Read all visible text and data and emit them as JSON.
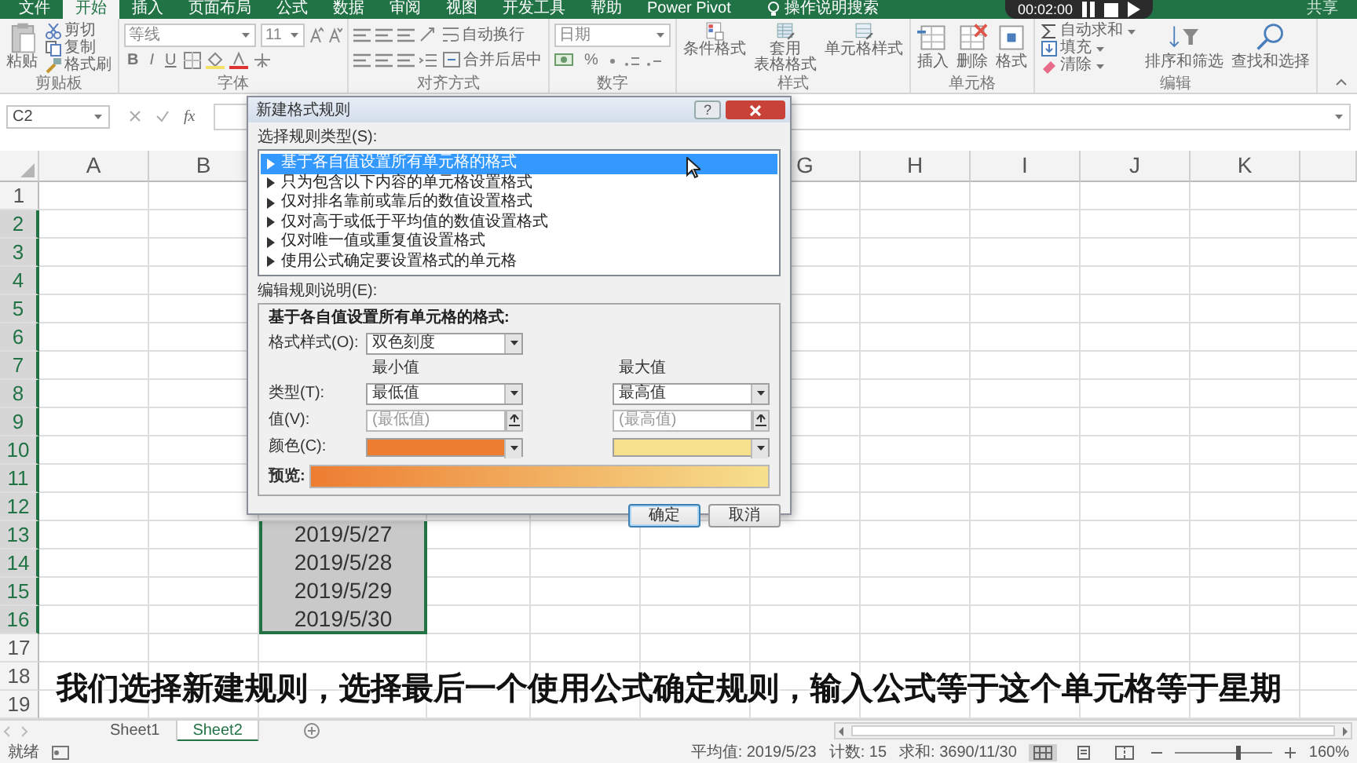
{
  "ribbon_tabs": [
    {
      "label": "文件",
      "selected": false
    },
    {
      "label": "开始",
      "selected": true
    },
    {
      "label": "插入",
      "selected": false
    },
    {
      "label": "页面布局",
      "selected": false
    },
    {
      "label": "公式",
      "selected": false
    },
    {
      "label": "数据",
      "selected": false
    },
    {
      "label": "审阅",
      "selected": false
    },
    {
      "label": "视图",
      "selected": false
    },
    {
      "label": "开发工具",
      "selected": false
    },
    {
      "label": "帮助",
      "selected": false
    },
    {
      "label": "Power Pivot",
      "selected": false
    }
  ],
  "tell_me": "操作说明搜索",
  "share": "共享",
  "video_controls": {
    "time": "00:02:00"
  },
  "ribbon_groups": [
    {
      "kind": "clipboard",
      "label": "剪贴板",
      "paste": "粘贴",
      "items": [
        "剪切",
        "复制",
        "格式刷"
      ]
    },
    {
      "kind": "font",
      "label": "字体",
      "font_name": "等线",
      "font_size": "11",
      "styles": [
        "B",
        "I",
        "U"
      ]
    },
    {
      "kind": "alignment",
      "label": "对齐方式",
      "wrap": "自动换行",
      "merge": "合并后居中"
    },
    {
      "kind": "number",
      "label": "数字",
      "format": "日期",
      "percent": "%"
    },
    {
      "kind": "styles",
      "label": "样式",
      "buttons": [
        [
          "条件格式"
        ],
        [
          "套用",
          "表格格式"
        ],
        [
          "单元格样式"
        ]
      ]
    },
    {
      "kind": "cells",
      "label": "单元格",
      "buttons": [
        "插入",
        "删除",
        "格式"
      ]
    },
    {
      "kind": "editing",
      "label": "编辑",
      "items": [
        "自动求和",
        "填充",
        "清除"
      ],
      "buttons": [
        "排序和筛选",
        "查找和选择"
      ]
    }
  ],
  "formula_bar": {
    "name_box": "C2",
    "function_label": "fx"
  },
  "sheet": {
    "columns": [
      "A",
      "B",
      null,
      null,
      null,
      null,
      "G",
      "H",
      "I",
      "J",
      "K"
    ],
    "rows": [
      {
        "label": "1",
        "selected": false
      },
      {
        "label": "2",
        "selected": true
      },
      {
        "label": "3",
        "selected": true
      },
      {
        "label": "4",
        "selected": true
      },
      {
        "label": "5",
        "selected": true
      },
      {
        "label": "6",
        "selected": true
      },
      {
        "label": "7",
        "selected": true
      },
      {
        "label": "8",
        "selected": true
      },
      {
        "label": "9",
        "selected": true
      },
      {
        "label": "10",
        "selected": true
      },
      {
        "label": "11",
        "selected": true
      },
      {
        "label": "12",
        "selected": true
      },
      {
        "label": "13",
        "selected": true,
        "cells": [
          null,
          null,
          "2019/5/27"
        ]
      },
      {
        "label": "14",
        "selected": true,
        "cells": [
          null,
          null,
          "2019/5/28"
        ]
      },
      {
        "label": "15",
        "selected": true,
        "cells": [
          null,
          null,
          "2019/5/29"
        ]
      },
      {
        "label": "16",
        "selected": true,
        "cells": [
          null,
          null,
          "2019/5/30"
        ]
      },
      {
        "label": "17",
        "selected": false
      },
      {
        "label": "18",
        "selected": false
      },
      {
        "label": "19",
        "selected": false
      }
    ]
  },
  "subtitle": "我们选择新建规则，选择最后一个使用公式确定规则，输入公式等于这个单元格等于星期",
  "sheet_tabs": [
    {
      "label": "Sheet1",
      "selected": false
    },
    {
      "label": "Sheet2",
      "selected": true
    }
  ],
  "status_bar": {
    "ready": "就绪",
    "average": "平均值: 2019/5/23",
    "count": "计数: 15",
    "sum": "求和: 3690/11/30",
    "views": [
      {
        "selected": true
      },
      {
        "selected": false
      },
      {
        "selected": false
      }
    ],
    "zoom_slider": {
      "level": 0.62
    },
    "zoom": "160%"
  },
  "dialog": {
    "title": "新建格式规则",
    "help": "?",
    "rule_type_label": "选择规则类型(S):",
    "rule_types": [
      {
        "label": "基于各自值设置所有单元格的格式",
        "selected": true
      },
      {
        "label": "只为包含以下内容的单元格设置格式",
        "selected": false
      },
      {
        "label": "仅对排名靠前或靠后的数值设置格式",
        "selected": false
      },
      {
        "label": "仅对高于或低于平均值的数值设置格式",
        "selected": false
      },
      {
        "label": "仅对唯一值或重复值设置格式",
        "selected": false
      },
      {
        "label": "使用公式确定要设置格式的单元格",
        "selected": false
      }
    ],
    "edit_label": "编辑规则说明(E):",
    "description_title": "基于各自值设置所有单元格的格式:",
    "format_style_label": "格式样式(O):",
    "format_style": "双色刻度",
    "min_heading": "最小值",
    "max_heading": "最大值",
    "type_label": "类型(T):",
    "min_type": "最低值",
    "max_type": "最高值",
    "value_label": "值(V):",
    "min_value_placeholder": "(最低值)",
    "max_value_placeholder": "(最高值)",
    "color_label": "颜色(C):",
    "color_pickers": [
      {
        "color": "#ed7d31"
      },
      {
        "color": "#f6e08e"
      }
    ],
    "preview_label": "预览:",
    "buttons": [
      {
        "label": "确定",
        "default": true
      },
      {
        "label": "取消",
        "default": false
      }
    ]
  }
}
